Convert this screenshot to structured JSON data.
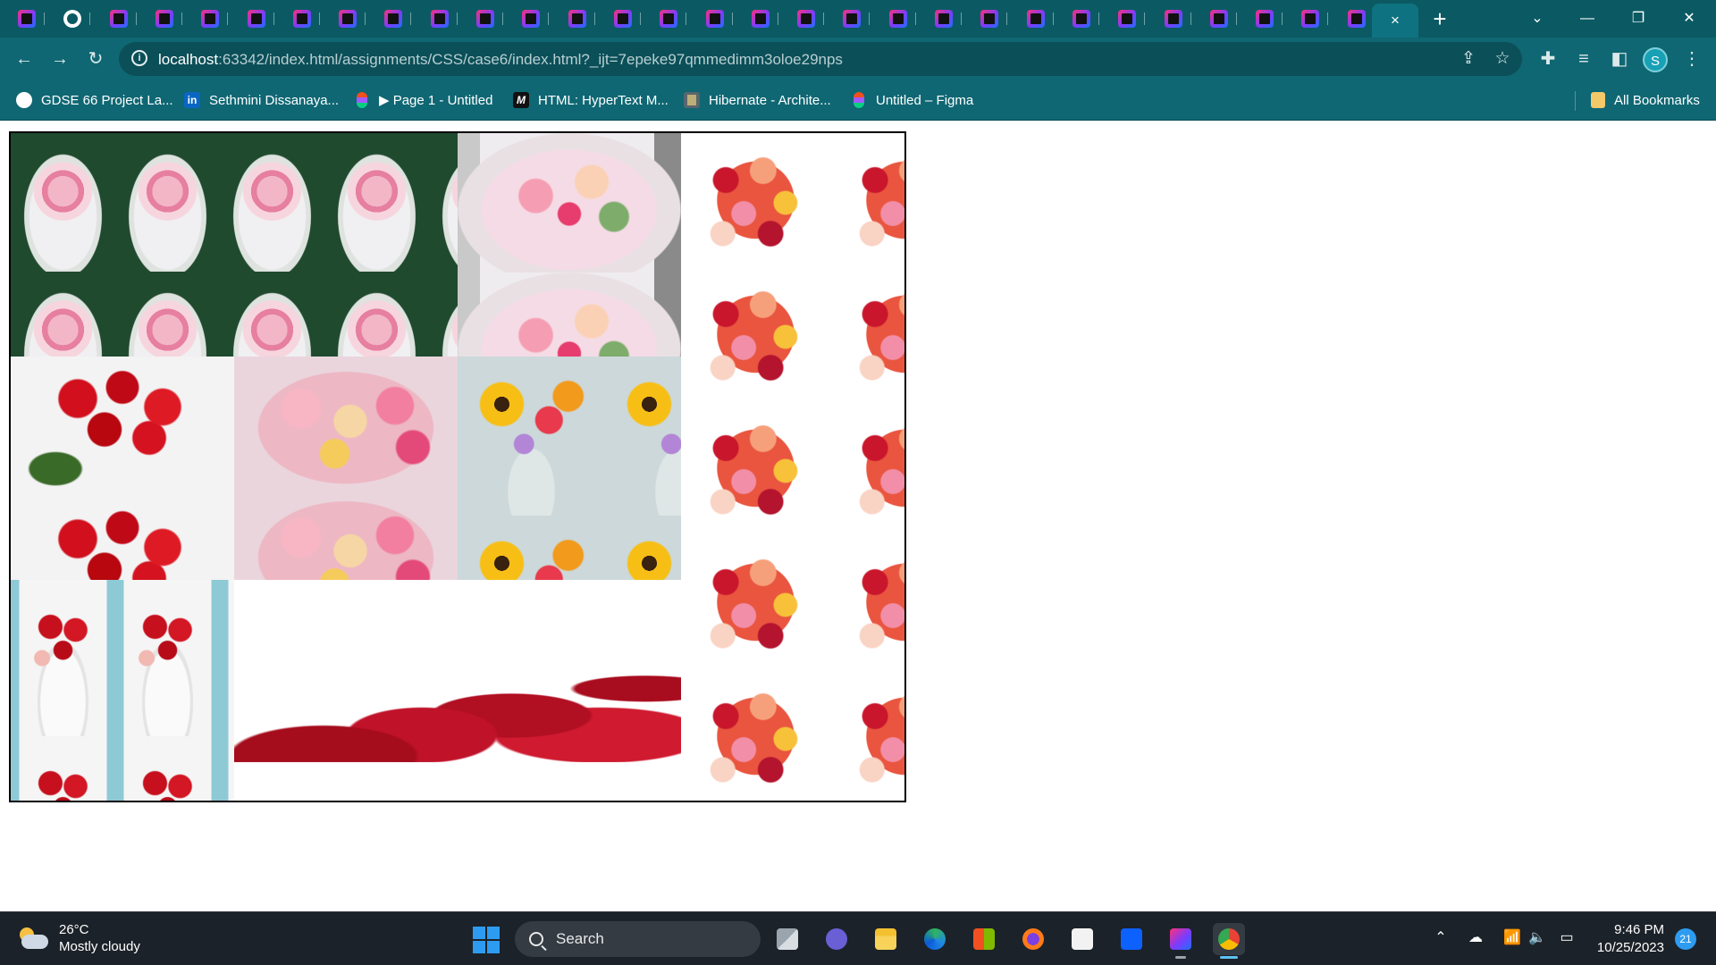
{
  "browser": {
    "address": {
      "host": "localhost",
      "rest": ":63342/index.html/assignments/CSS/case6/index.html?_ijt=7epeke97qmmedimm3oloe29nps"
    },
    "active_tab_close": "×",
    "new_tab": "+",
    "profile_initial": "S",
    "window_controls": {
      "minimize": "—",
      "restore": "❐",
      "close": "✕"
    },
    "nav": {
      "back": "←",
      "forward": "→",
      "reload": "↻"
    }
  },
  "bookmarks": [
    {
      "label": "GDSE 66 Project La...",
      "icon": "github-icon"
    },
    {
      "label": "Sethmini Dissanaya...",
      "icon": "linkedin-icon"
    },
    {
      "label": "▶ Page 1 - Untitled",
      "icon": "figma-icon"
    },
    {
      "label": "HTML: HyperText M...",
      "icon": "mdn-icon"
    },
    {
      "label": "Hibernate - Archite...",
      "icon": "hibernate-icon"
    },
    {
      "label": "Untitled – Figma",
      "icon": "figma-icon"
    }
  ],
  "all_bookmarks": "All Bookmarks",
  "gallery": {
    "tiles": [
      {
        "name": "pink-bouquet-green-background",
        "subject": "pink rose bouquet in white wrap"
      },
      {
        "name": "pastel-bouquet-wrapped",
        "subject": "pastel mixed bouquet in pink wrap"
      },
      {
        "name": "mixed-roses-bouquet",
        "subject": "mixed red, peach and yellow roses"
      },
      {
        "name": "red-roses-bunch",
        "subject": "red roses bunch"
      },
      {
        "name": "peach-pink-bouquet",
        "subject": "peach and pink garden roses"
      },
      {
        "name": "sunflower-vase-arrangement",
        "subject": "sunflowers and roses in glass vase"
      },
      {
        "name": "red-roses-white-wrap",
        "subject": "red roses in white wrap"
      },
      {
        "name": "large-red-roses",
        "subject": "close-up red roses"
      }
    ]
  },
  "taskbar": {
    "weather": {
      "temp": "26°C",
      "condition": "Mostly cloudy"
    },
    "search_label": "Search",
    "time": "9:46 PM",
    "date": "10/25/2023",
    "notification_count": "21"
  }
}
